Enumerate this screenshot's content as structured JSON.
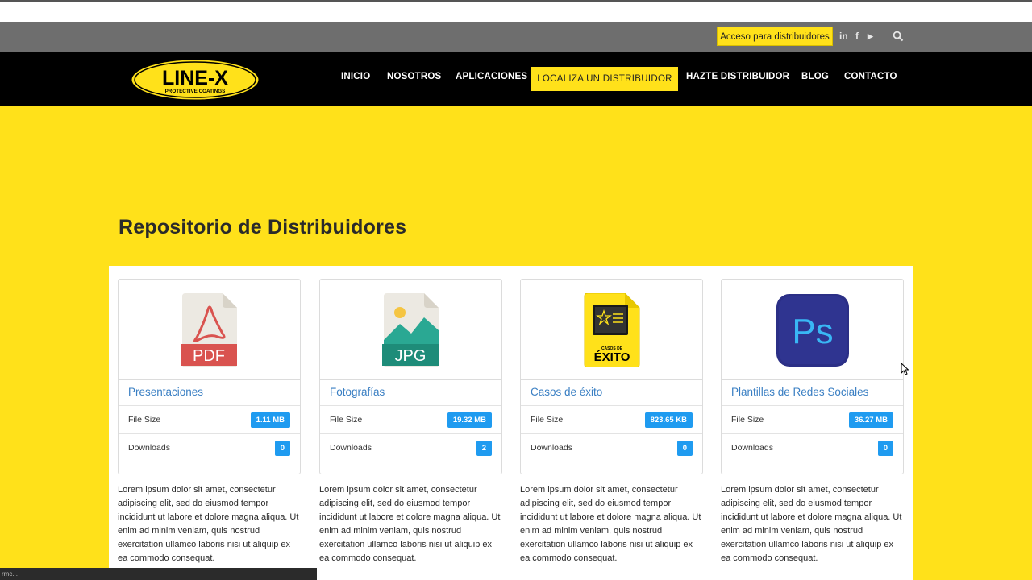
{
  "topbar": {
    "distributor_access": "Acceso para distribuidores",
    "social": [
      "linkedin-icon",
      "facebook-icon",
      "youtube-icon"
    ],
    "social_glyphs": {
      "linkedin": "in",
      "facebook": "f",
      "youtube": "▶"
    }
  },
  "logo": {
    "text": "LINE-X",
    "tagline": "PROTECTIVE COATINGS"
  },
  "nav": {
    "items": [
      "INICIO",
      "NOSOTROS",
      "APLICACIONES",
      "LOCALIZA UN DISTRIBUIDOR",
      "HAZTE DISTRIBUIDOR",
      "BLOG",
      "CONTACTO"
    ]
  },
  "page": {
    "title": "Repositorio de Distribuidores"
  },
  "cards": [
    {
      "title": "Presentaciones",
      "icon": "pdf-file-icon",
      "icon_text": "PDF",
      "file_size_label": "File Size",
      "file_size": "1.11 MB",
      "downloads_label": "Downloads",
      "downloads": "0",
      "description": "Lorem ipsum dolor sit amet, consectetur adipiscing elit, sed do eiusmod tempor incididunt ut labore et dolore magna aliqua. Ut enim ad minim veniam, quis nostrud exercitation ullamco laboris nisi ut aliquip ex ea commodo consequat."
    },
    {
      "title": "Fotografías",
      "icon": "jpg-file-icon",
      "icon_text": "JPG",
      "file_size_label": "File Size",
      "file_size": "19.32 MB",
      "downloads_label": "Downloads",
      "downloads": "2",
      "description": "Lorem ipsum dolor sit amet, consectetur adipiscing elit, sed do eiusmod tempor incididunt ut labore et dolore magna aliqua. Ut enim ad minim veniam, quis nostrud exercitation ullamco laboris nisi ut aliquip ex ea commodo consequat."
    },
    {
      "title": "Casos de éxito",
      "icon": "success-cases-file-icon",
      "icon_text": "ÉXITO",
      "icon_subtext": "CASOS DE",
      "file_size_label": "File Size",
      "file_size": "823.65 KB",
      "downloads_label": "Downloads",
      "downloads": "0",
      "description": "Lorem ipsum dolor sit amet, consectetur adipiscing elit, sed do eiusmod tempor incididunt ut labore et dolore magna aliqua. Ut enim ad minim veniam, quis nostrud exercitation ullamco laboris nisi ut aliquip ex ea commodo consequat."
    },
    {
      "title": "Plantillas de Redes Sociales",
      "icon": "photoshop-icon",
      "icon_text": "Ps",
      "file_size_label": "File Size",
      "file_size": "36.27 MB",
      "downloads_label": "Downloads",
      "downloads": "0",
      "description": "Lorem ipsum dolor sit amet, consectetur adipiscing elit, sed do eiusmod tempor incididunt ut labore et dolore magna aliqua. Ut enim ad minim veniam, quis nostrud exercitation ullamco laboris nisi ut aliquip ex ea commodo consequat."
    }
  ],
  "status": {
    "text": "rmc..."
  },
  "colors": {
    "brand_yellow": "#ffe11a",
    "nav_black": "#000000",
    "badge_blue": "#1f9bf0",
    "link_blue": "#3a7fc3"
  }
}
